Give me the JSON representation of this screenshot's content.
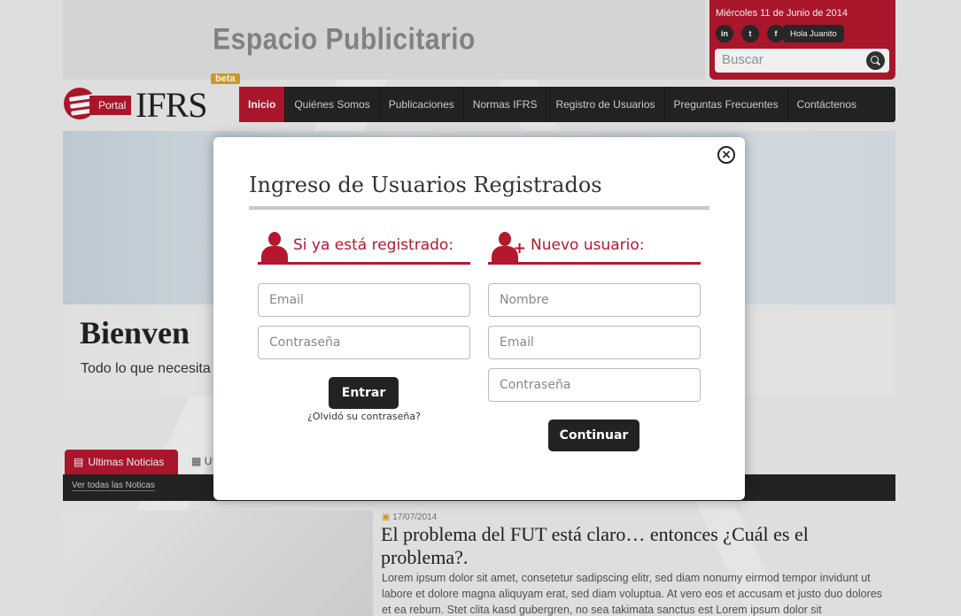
{
  "header": {
    "ad_text": "Espacio Publicitario",
    "date": "Miércoles 11 de Junio de 2014",
    "social": [
      "in",
      "t",
      "f"
    ],
    "greeting": "Hola Juanito",
    "search_placeholder": "Buscar",
    "logo_portal": "Portal",
    "logo_name": "IFRS",
    "logo_badge": "beta"
  },
  "nav": {
    "items": [
      "Inicio",
      "Quiénes Somos",
      "Publicaciones",
      "Normas IFRS",
      "Registro de Usuarios",
      "Preguntas Frecuentes",
      "Contáctenos"
    ]
  },
  "hero": {
    "title": "Bienven",
    "subtitle": "Todo lo que necesita"
  },
  "news": {
    "tab_active": "Ultimas Noticias",
    "tab_other": "U",
    "see_all": "Ver todas las Noticas",
    "date": "17/07/2014",
    "title": "El problema del FUT está claro… entonces ¿Cuál es el problema?.",
    "body": "Lorem ipsum dolor sit amet, consetetur sadipscing elitr, sed diam nonumy eirmod tempor invidunt ut labore et dolore magna aliquyam erat, sed diam voluptua. At vero eos et accusam et justo duo dolores et ea rebum. Stet clita kasd gubergren, no sea takimata sanctus est Lorem ipsum dolor sit"
  },
  "modal": {
    "close": "×",
    "title": "Ingreso de Usuarios Registrados",
    "login": {
      "heading": "Si ya está registrado:",
      "email_placeholder": "Email",
      "password_placeholder": "Contraseña",
      "submit": "Entrar",
      "forgot": "¿Olvidó su contraseña?"
    },
    "register": {
      "heading": "Nuevo usuario:",
      "name_placeholder": "Nombre",
      "email_placeholder": "Email",
      "password_placeholder": "Contraseña",
      "submit": "Continuar"
    }
  },
  "colors": {
    "brand": "#b4182f",
    "dark": "#252525",
    "accent": "#e0a021"
  }
}
